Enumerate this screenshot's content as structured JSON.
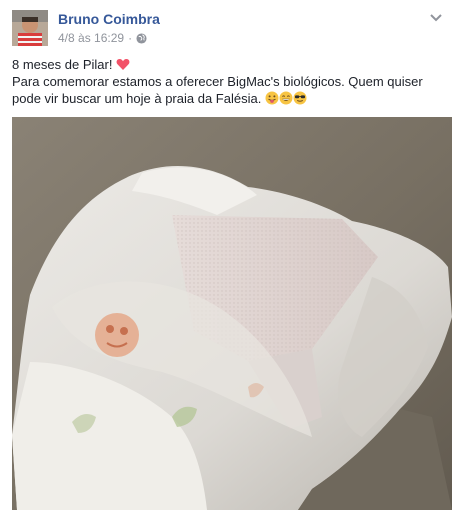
{
  "post": {
    "author": "Bruno Coimbra",
    "date": "4/8 às 16:29",
    "separator": "·",
    "line1": "8 meses de Pilar!",
    "line2": "Para comemorar estamos a oferecer BigMac's biológicos. Quem quiser pode vir buscar um hoje à praia da Falésia.",
    "icons": {
      "heart": "heart-icon",
      "globe": "globe-icon",
      "menu": "chevron-down-icon",
      "emojis": [
        "tongue-out-emoji",
        "grin-emoji",
        "sunglasses-emoji"
      ]
    },
    "colors": {
      "author": "#365899",
      "meta": "#90949c",
      "text": "#1d2129",
      "heart": "#f25268"
    }
  }
}
